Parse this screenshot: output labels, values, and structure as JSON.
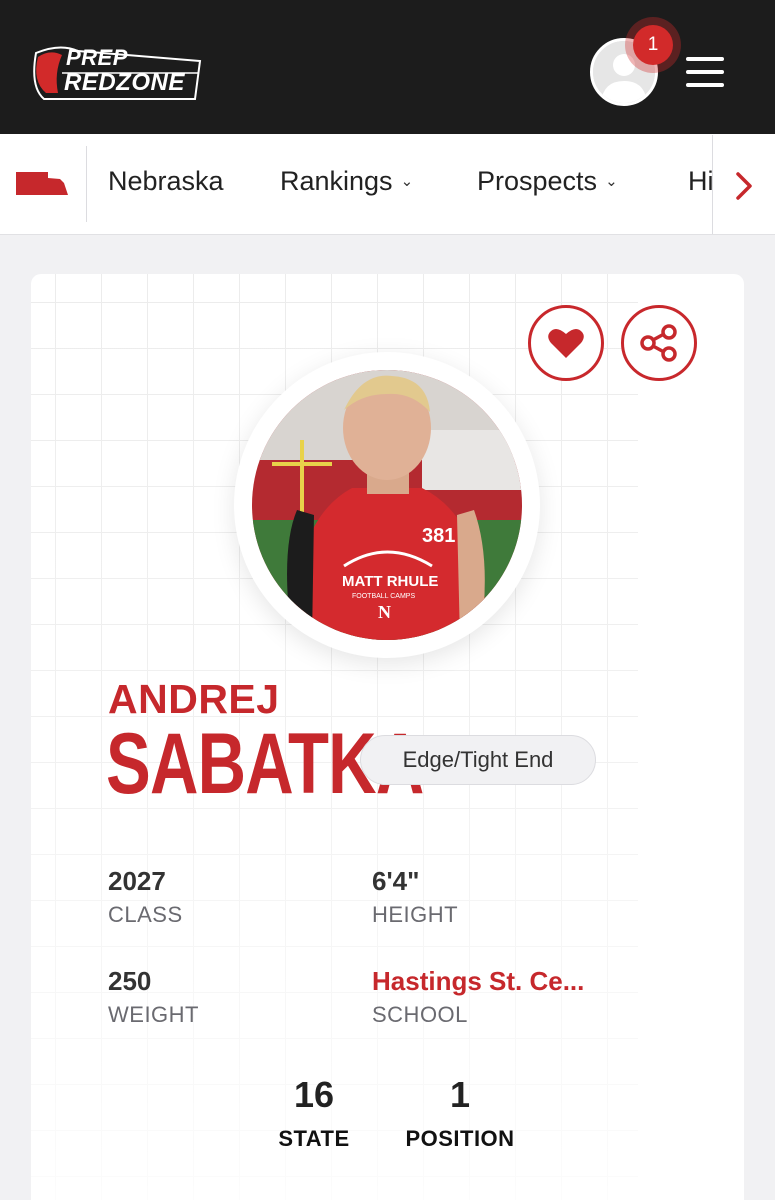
{
  "header": {
    "logo_word1": "PREP",
    "logo_word2": "REDZONE",
    "notification_count": "1",
    "icons": {
      "avatar": "user-avatar-icon",
      "menu": "hamburger-menu-icon"
    }
  },
  "subnav": {
    "state_icon": "nebraska-state-icon",
    "items": [
      {
        "label": "Nebraska",
        "has_dropdown": false
      },
      {
        "label": "Rankings",
        "has_dropdown": true
      },
      {
        "label": "Prospects",
        "has_dropdown": true
      },
      {
        "label": "Hi",
        "has_dropdown": false
      }
    ],
    "next_icon": "chevron-right-icon"
  },
  "profile": {
    "first_name": "ANDREJ",
    "last_name": "SABATKA",
    "position": "Edge/Tight End",
    "photo_shirt_number": "381",
    "photo_shirt_line1": "MATT RHULE",
    "photo_shirt_line2": "FOOTBALL CAMPS",
    "photo_shirt_letter": "N",
    "stats": {
      "class_value": "2027",
      "class_label": "CLASS",
      "height_value": "6'4\"",
      "height_label": "HEIGHT",
      "weight_value": "250",
      "weight_label": "WEIGHT",
      "school_value": "Hastings St. Ce...",
      "school_label": "SCHOOL"
    },
    "rankings": {
      "state_value": "16",
      "state_label": "STATE",
      "position_value": "1",
      "position_label": "POSITION"
    },
    "actions": {
      "favorite_icon": "heart-icon",
      "share_icon": "share-icon"
    }
  },
  "colors": {
    "brand_red": "#c6282c",
    "header_bg": "#1c1c1c",
    "badge_red": "#d22a2a",
    "page_bg": "#f1f1f3"
  }
}
